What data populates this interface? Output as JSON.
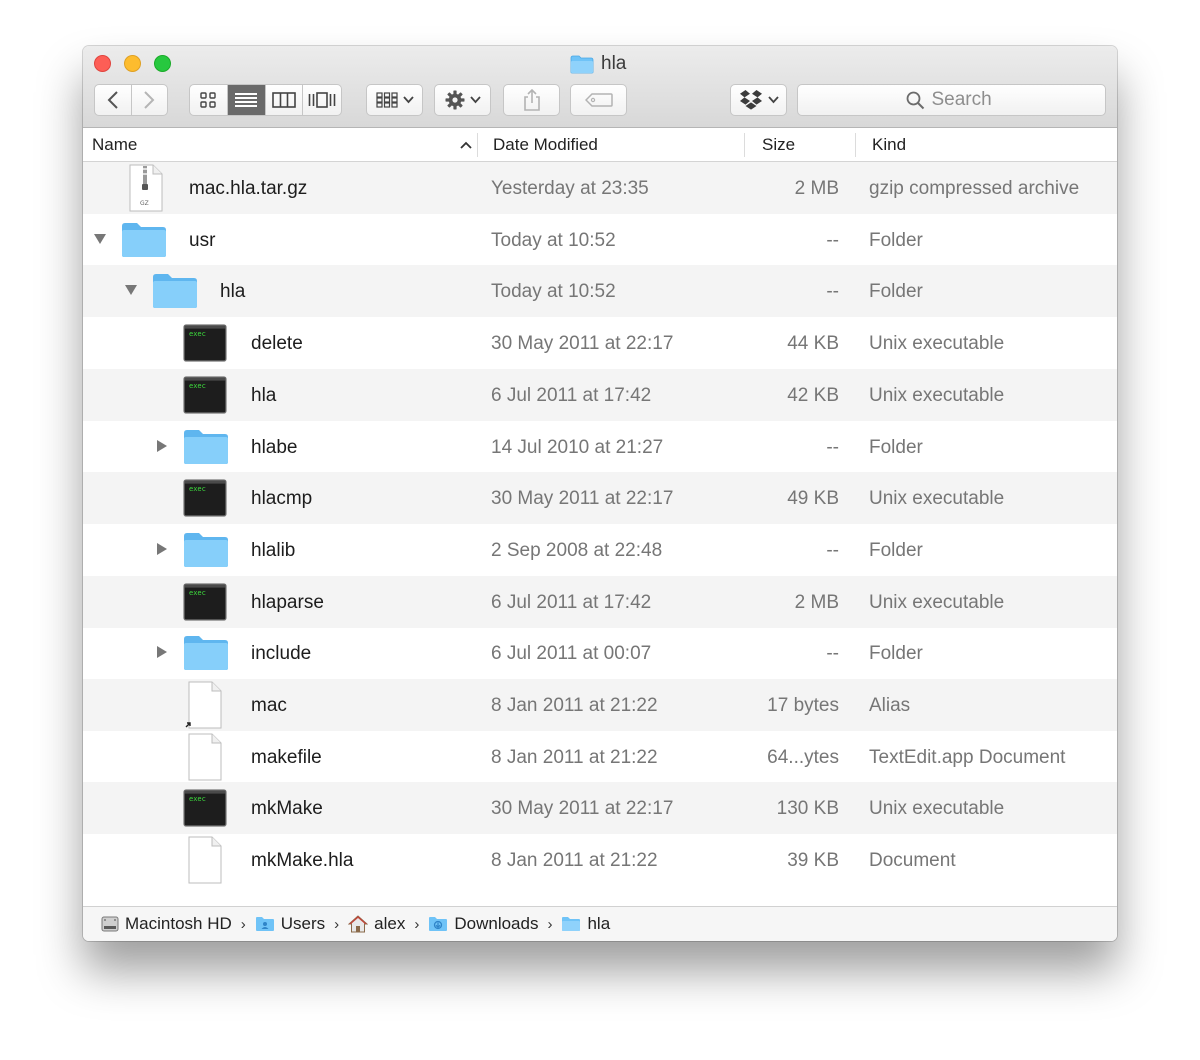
{
  "window": {
    "title": "hla"
  },
  "toolbar": {
    "back_icon": "chevron-left-icon",
    "forward_icon": "chevron-right-icon",
    "view_modes": [
      "icon-view",
      "list-view",
      "column-view",
      "cover-flow-view"
    ],
    "active_view": "list-view",
    "search_placeholder": "Search"
  },
  "columns": {
    "name": "Name",
    "date": "Date Modified",
    "size": "Size",
    "kind": "Kind",
    "sort_indicator": "^"
  },
  "files": [
    {
      "name": "mac.hla.tar.gz",
      "date": "Yesterday at 23:35",
      "size": "2 MB",
      "kind": "gzip compressed archive",
      "icon": "archive-icon",
      "depth": 0,
      "disclosure": "none"
    },
    {
      "name": "usr",
      "date": "Today at 10:52",
      "size": "--",
      "kind": "Folder",
      "icon": "folder-icon",
      "depth": 0,
      "disclosure": "expanded"
    },
    {
      "name": "hla",
      "date": "Today at 10:52",
      "size": "--",
      "kind": "Folder",
      "icon": "folder-icon",
      "depth": 1,
      "disclosure": "expanded"
    },
    {
      "name": "delete",
      "date": "30 May 2011 at 22:17",
      "size": "44 KB",
      "kind": "Unix executable",
      "icon": "exec-icon",
      "depth": 2,
      "disclosure": "none"
    },
    {
      "name": "hla",
      "date": "6 Jul 2011 at 17:42",
      "size": "42 KB",
      "kind": "Unix executable",
      "icon": "exec-icon",
      "depth": 2,
      "disclosure": "none"
    },
    {
      "name": "hlabe",
      "date": "14 Jul 2010 at 21:27",
      "size": "--",
      "kind": "Folder",
      "icon": "folder-icon",
      "depth": 2,
      "disclosure": "collapsed"
    },
    {
      "name": "hlacmp",
      "date": "30 May 2011 at 22:17",
      "size": "49 KB",
      "kind": "Unix executable",
      "icon": "exec-icon",
      "depth": 2,
      "disclosure": "none"
    },
    {
      "name": "hlalib",
      "date": "2 Sep 2008 at 22:48",
      "size": "--",
      "kind": "Folder",
      "icon": "folder-icon",
      "depth": 2,
      "disclosure": "collapsed"
    },
    {
      "name": "hlaparse",
      "date": "6 Jul 2011 at 17:42",
      "size": "2 MB",
      "kind": "Unix executable",
      "icon": "exec-icon",
      "depth": 2,
      "disclosure": "none"
    },
    {
      "name": "include",
      "date": "6 Jul 2011 at 00:07",
      "size": "--",
      "kind": "Folder",
      "icon": "folder-icon",
      "depth": 2,
      "disclosure": "collapsed"
    },
    {
      "name": "mac",
      "date": "8 Jan 2011 at 21:22",
      "size": "17 bytes",
      "kind": "Alias",
      "icon": "alias-icon",
      "depth": 2,
      "disclosure": "none"
    },
    {
      "name": "makefile",
      "date": "8 Jan 2011 at 21:22",
      "size": "64...ytes",
      "kind": "TextEdit.app Document",
      "icon": "document-icon",
      "depth": 2,
      "disclosure": "none"
    },
    {
      "name": "mkMake",
      "date": "30 May 2011 at 22:17",
      "size": "130 KB",
      "kind": "Unix executable",
      "icon": "exec-icon",
      "depth": 2,
      "disclosure": "none"
    },
    {
      "name": "mkMake.hla",
      "date": "8 Jan 2011 at 21:22",
      "size": "39 KB",
      "kind": "Document",
      "icon": "document-icon",
      "depth": 2,
      "disclosure": "none"
    }
  ],
  "icon_labels": {
    "exec": "exec",
    "archive": "GZ"
  },
  "pathbar": [
    {
      "label": "Macintosh HD",
      "icon": "hard-drive-icon"
    },
    {
      "label": "Users",
      "icon": "users-folder-icon"
    },
    {
      "label": "alex",
      "icon": "home-icon"
    },
    {
      "label": "Downloads",
      "icon": "downloads-folder-icon"
    },
    {
      "label": "hla",
      "icon": "folder-icon"
    }
  ],
  "colors": {
    "folder": "#6fc3f7",
    "exec_text": "#3ddc3d",
    "active_segment": "#6a6a6a"
  }
}
